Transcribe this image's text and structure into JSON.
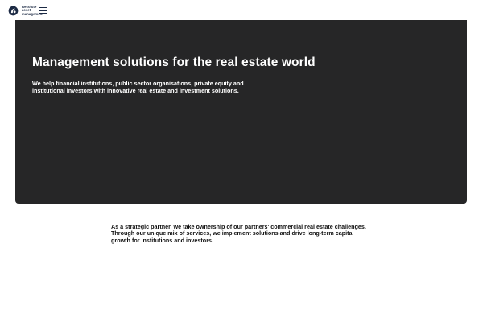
{
  "header": {
    "logo": {
      "icon": "swirl-logo-mark",
      "text_lines": [
        "Resolute",
        "asset",
        "management"
      ],
      "color": "#1c2a44"
    },
    "menu_icon": "hamburger-menu-icon"
  },
  "hero": {
    "background_color": "#262627",
    "title": "Management solutions for the real estate world",
    "subtitle": "We help financial institutions, public sector organisations, private equity and institutional investors with innovative real estate and investment solutions."
  },
  "intro": {
    "text": "As a strategic partner, we take ownership of our partners' commercial real estate challenges. Through our unique mix of services, we implement solutions and drive long-term capital growth for institutions and investors."
  }
}
